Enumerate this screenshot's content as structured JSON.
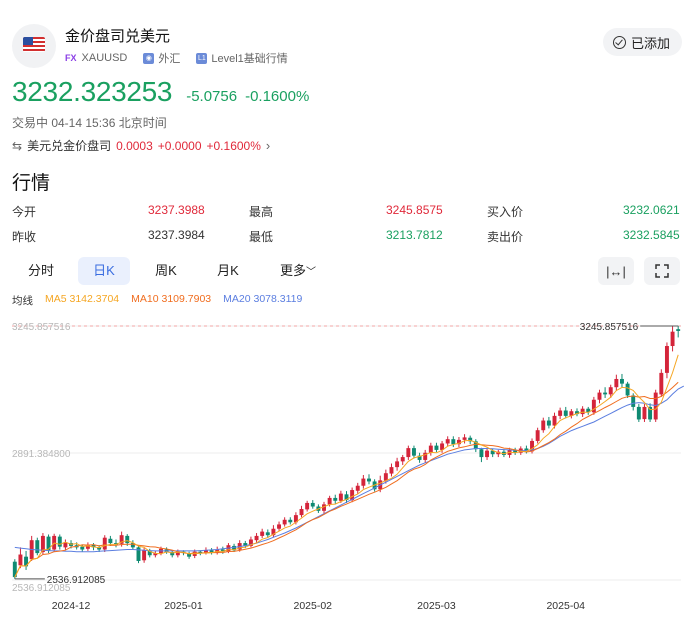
{
  "header": {
    "title": "金价盘司兑美元",
    "fx_badge": "FX",
    "symbol": "XAUUSD",
    "market": "外汇",
    "level": "Level1基础行情",
    "added_label": "已添加"
  },
  "quote": {
    "price": "3232.323253",
    "change": "-5.0756",
    "change_pct": "-0.1600%",
    "status": "交易中 04-14 15:36 北京时间",
    "cross_label": "美元兑金价盘司",
    "cross_price": "0.0003",
    "cross_change": "+0.0000",
    "cross_pct": "+0.1600%"
  },
  "section_title": "行情",
  "stats": {
    "open_label": "今开",
    "open": "3237.3988",
    "high_label": "最高",
    "high": "3245.8575",
    "bid_label": "买入价",
    "bid": "3232.0621",
    "prev_label": "昨收",
    "prev": "3237.3984",
    "low_label": "最低",
    "low": "3213.7812",
    "ask_label": "卖出价",
    "ask": "3232.5845"
  },
  "tabs": {
    "intraday": "分时",
    "daily": "日K",
    "weekly": "周K",
    "monthly": "月K",
    "more": "更多"
  },
  "ma_legend": {
    "label": "均线",
    "ma5": "MA5 3142.3704",
    "ma10": "MA10 3109.7903",
    "ma20": "MA20 3078.3119"
  },
  "colors": {
    "up": "#d4243a",
    "down": "#0f8a72",
    "ma5": "#f5a623",
    "ma10": "#f06d1f",
    "ma20": "#5b7ee0",
    "accent": "#3a6de0"
  },
  "chart_data": {
    "type": "candlestick",
    "y_tick_labels": [
      "3245.857516",
      "2891.384800",
      "2536.912085"
    ],
    "max_marker": "3245.857516",
    "min_marker": "2536.912085",
    "x_tick_labels": [
      "2024-12",
      "2025-01",
      "2025-02",
      "2025-03",
      "2025-04"
    ],
    "ylim": [
      2536.912085,
      3245.857516
    ],
    "candles": [
      [
        2588,
        2545,
        2540,
        2595
      ],
      [
        2578,
        2608,
        2570,
        2628
      ],
      [
        2602,
        2575,
        2565,
        2618
      ],
      [
        2595,
        2648,
        2590,
        2660
      ],
      [
        2648,
        2612,
        2606,
        2655
      ],
      [
        2615,
        2660,
        2608,
        2668
      ],
      [
        2658,
        2620,
        2612,
        2664
      ],
      [
        2622,
        2660,
        2615,
        2666
      ],
      [
        2658,
        2630,
        2622,
        2664
      ],
      [
        2628,
        2642,
        2620,
        2650
      ],
      [
        2640,
        2632,
        2625,
        2648
      ],
      [
        2634,
        2628,
        2622,
        2642
      ],
      [
        2630,
        2622,
        2615,
        2636
      ],
      [
        2624,
        2636,
        2618,
        2642
      ],
      [
        2636,
        2628,
        2620,
        2640
      ],
      [
        2628,
        2622,
        2615,
        2634
      ],
      [
        2622,
        2655,
        2615,
        2662
      ],
      [
        2652,
        2640,
        2632,
        2660
      ],
      [
        2640,
        2636,
        2628,
        2650
      ],
      [
        2638,
        2662,
        2630,
        2672
      ],
      [
        2660,
        2640,
        2632,
        2665
      ],
      [
        2640,
        2628,
        2622,
        2648
      ],
      [
        2628,
        2590,
        2584,
        2632
      ],
      [
        2592,
        2620,
        2585,
        2626
      ],
      [
        2618,
        2606,
        2600,
        2624
      ],
      [
        2606,
        2612,
        2600,
        2618
      ],
      [
        2612,
        2624,
        2606,
        2630
      ],
      [
        2622,
        2615,
        2610,
        2628
      ],
      [
        2615,
        2606,
        2600,
        2620
      ],
      [
        2606,
        2616,
        2600,
        2622
      ],
      [
        2616,
        2612,
        2606,
        2620
      ],
      [
        2612,
        2602,
        2596,
        2616
      ],
      [
        2604,
        2616,
        2598,
        2622
      ],
      [
        2616,
        2612,
        2606,
        2620
      ],
      [
        2612,
        2620,
        2608,
        2628
      ],
      [
        2620,
        2614,
        2608,
        2626
      ],
      [
        2614,
        2622,
        2608,
        2630
      ],
      [
        2622,
        2616,
        2610,
        2630
      ],
      [
        2616,
        2634,
        2612,
        2640
      ],
      [
        2632,
        2620,
        2615,
        2638
      ],
      [
        2622,
        2640,
        2616,
        2648
      ],
      [
        2640,
        2632,
        2626,
        2646
      ],
      [
        2632,
        2650,
        2628,
        2658
      ],
      [
        2648,
        2660,
        2640,
        2668
      ],
      [
        2660,
        2672,
        2654,
        2680
      ],
      [
        2670,
        2662,
        2655,
        2678
      ],
      [
        2662,
        2680,
        2656,
        2690
      ],
      [
        2680,
        2692,
        2674,
        2700
      ],
      [
        2692,
        2705,
        2686,
        2712
      ],
      [
        2705,
        2698,
        2692,
        2712
      ],
      [
        2698,
        2718,
        2692,
        2726
      ],
      [
        2718,
        2735,
        2712,
        2744
      ],
      [
        2734,
        2752,
        2728,
        2758
      ],
      [
        2752,
        2742,
        2736,
        2760
      ],
      [
        2742,
        2730,
        2724,
        2748
      ],
      [
        2730,
        2748,
        2722,
        2755
      ],
      [
        2748,
        2766,
        2742,
        2772
      ],
      [
        2766,
        2758,
        2750,
        2775
      ],
      [
        2758,
        2778,
        2752,
        2786
      ],
      [
        2776,
        2760,
        2752,
        2785
      ],
      [
        2760,
        2788,
        2754,
        2795
      ],
      [
        2786,
        2800,
        2778,
        2808
      ],
      [
        2800,
        2820,
        2792,
        2830
      ],
      [
        2820,
        2812,
        2804,
        2832
      ],
      [
        2812,
        2790,
        2784,
        2818
      ],
      [
        2790,
        2815,
        2782,
        2828
      ],
      [
        2814,
        2835,
        2806,
        2845
      ],
      [
        2834,
        2852,
        2826,
        2862
      ],
      [
        2852,
        2868,
        2842,
        2878
      ],
      [
        2868,
        2880,
        2858,
        2886
      ],
      [
        2880,
        2905,
        2872,
        2912
      ],
      [
        2905,
        2884,
        2876,
        2912
      ],
      [
        2884,
        2872,
        2864,
        2892
      ],
      [
        2872,
        2892,
        2864,
        2900
      ],
      [
        2892,
        2912,
        2884,
        2920
      ],
      [
        2912,
        2900,
        2894,
        2920
      ],
      [
        2900,
        2918,
        2892,
        2925
      ],
      [
        2918,
        2930,
        2910,
        2938
      ],
      [
        2930,
        2916,
        2908,
        2938
      ],
      [
        2916,
        2928,
        2908,
        2936
      ],
      [
        2928,
        2935,
        2918,
        2944
      ],
      [
        2934,
        2924,
        2916,
        2940
      ],
      [
        2924,
        2902,
        2894,
        2930
      ],
      [
        2902,
        2880,
        2866,
        2906
      ],
      [
        2880,
        2898,
        2872,
        2906
      ],
      [
        2898,
        2888,
        2880,
        2904
      ],
      [
        2888,
        2895,
        2880,
        2900
      ],
      [
        2895,
        2886,
        2880,
        2902
      ],
      [
        2886,
        2900,
        2878,
        2906
      ],
      [
        2900,
        2892,
        2886,
        2906
      ],
      [
        2892,
        2904,
        2886,
        2910
      ],
      [
        2904,
        2896,
        2890,
        2912
      ],
      [
        2896,
        2925,
        2890,
        2932
      ],
      [
        2925,
        2955,
        2918,
        2962
      ],
      [
        2955,
        2982,
        2948,
        2990
      ],
      [
        2982,
        2968,
        2960,
        2992
      ],
      [
        2968,
        2995,
        2960,
        3004
      ],
      [
        2995,
        3010,
        2986,
        3018
      ],
      [
        3010,
        2995,
        2988,
        3020
      ],
      [
        2995,
        3008,
        2988,
        3014
      ],
      [
        3008,
        3000,
        2994,
        3016
      ],
      [
        3000,
        3015,
        2992,
        3022
      ],
      [
        3015,
        3005,
        2998,
        3020
      ],
      [
        3005,
        3040,
        2998,
        3048
      ],
      [
        3040,
        3060,
        3030,
        3068
      ],
      [
        3060,
        3055,
        3045,
        3075
      ],
      [
        3055,
        3075,
        3045,
        3082
      ],
      [
        3075,
        3098,
        3065,
        3110
      ],
      [
        3098,
        3085,
        3075,
        3112
      ],
      [
        3085,
        3052,
        3045,
        3090
      ],
      [
        3052,
        3020,
        3010,
        3058
      ],
      [
        3020,
        2985,
        2978,
        3028
      ],
      [
        2986,
        3020,
        2978,
        3028
      ],
      [
        3020,
        2985,
        2978,
        3030
      ],
      [
        2985,
        3060,
        2978,
        3068
      ],
      [
        3055,
        3115,
        3048,
        3125
      ],
      [
        3115,
        3190,
        3100,
        3200
      ],
      [
        3190,
        3230,
        3175,
        3245
      ],
      [
        3237,
        3232,
        3214,
        3246
      ]
    ],
    "ma20": [
      2628,
      2626,
      2624,
      2622,
      2621,
      2620,
      2619,
      2618,
      2618,
      2617,
      2617,
      2616,
      2616,
      2616,
      2616,
      2617,
      2618,
      2619,
      2620,
      2621,
      2622,
      2622,
      2621,
      2620,
      2619,
      2618,
      2618,
      2618,
      2618,
      2618,
      2618,
      2618,
      2618,
      2619,
      2620,
      2621,
      2622,
      2624,
      2626,
      2628,
      2630,
      2633,
      2636,
      2640,
      2645,
      2650,
      2656,
      2662,
      2668,
      2675,
      2682,
      2690,
      2698,
      2706,
      2714,
      2722,
      2730,
      2738,
      2746,
      2754,
      2762,
      2770,
      2778,
      2786,
      2794,
      2802,
      2810,
      2818,
      2826,
      2834,
      2842,
      2850,
      2858,
      2864,
      2870,
      2876,
      2882,
      2888,
      2892,
      2896,
      2900,
      2902,
      2904,
      2904,
      2904,
      2903,
      2902,
      2901,
      2900,
      2899,
      2898,
      2898,
      2900,
      2904,
      2910,
      2918,
      2928,
      2938,
      2946,
      2954,
      2960,
      2966,
      2972,
      2978,
      2986,
      2994,
      3002,
      3010,
      3018,
      3025,
      3030,
      3032,
      3030,
      3026,
      3024,
      3030,
      3040,
      3056,
      3070,
      3078
    ]
  }
}
